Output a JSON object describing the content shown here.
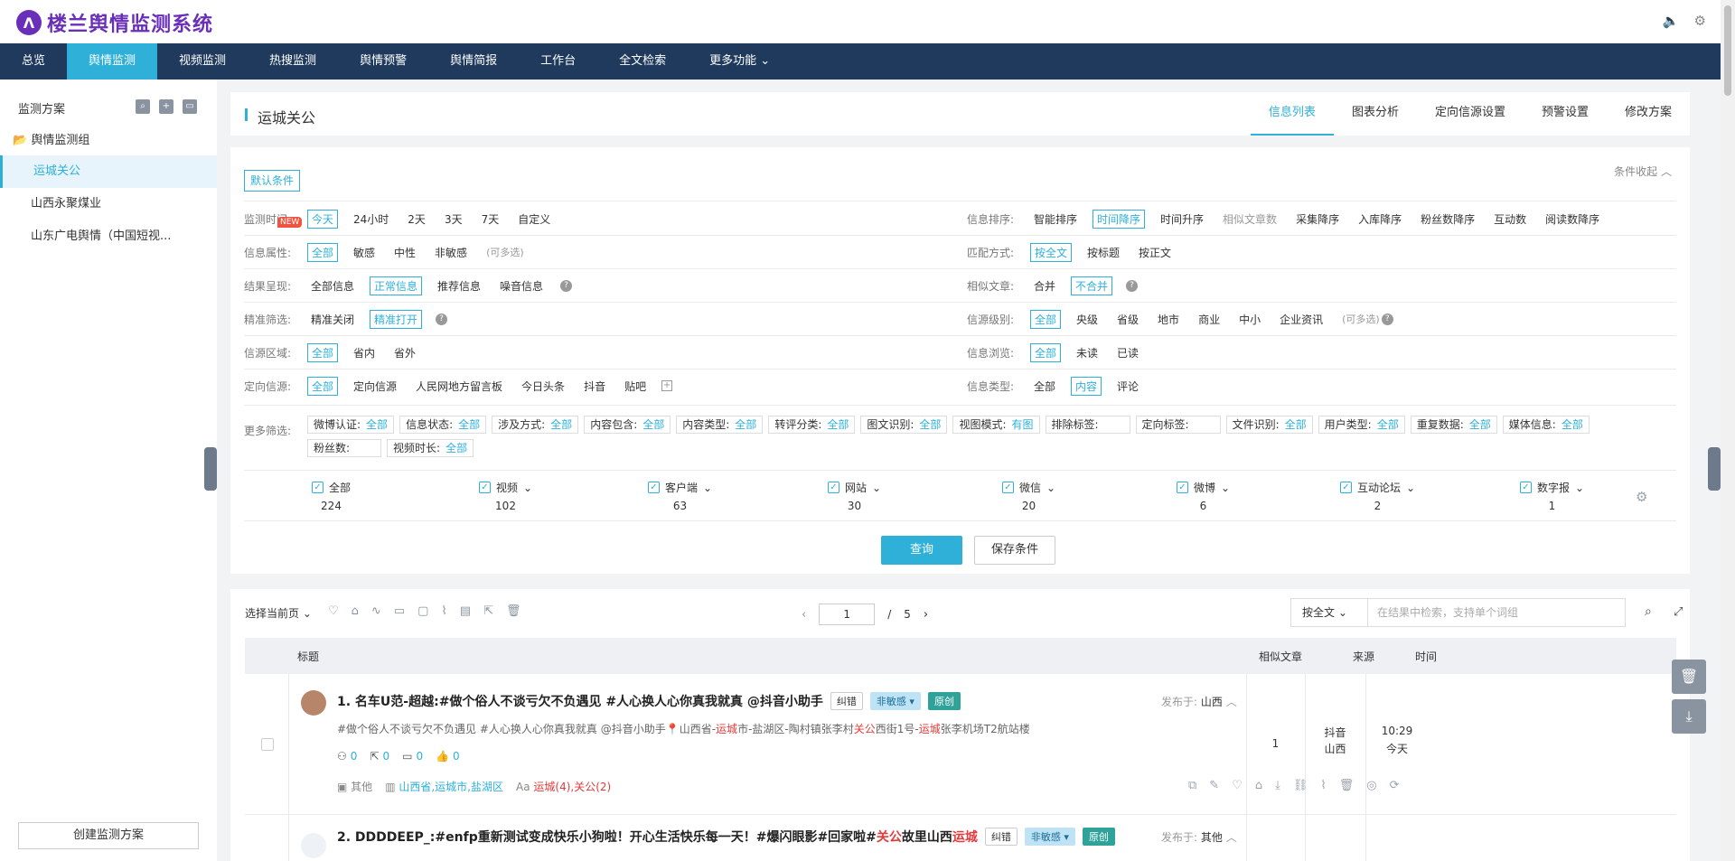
{
  "app": {
    "logo_char": "Λ",
    "title": "楼兰舆情监测系统"
  },
  "top_icons": [
    "speaker-icon",
    "gear-icon"
  ],
  "nav": [
    "总览",
    "舆情监测",
    "视频监测",
    "热搜监测",
    "舆情预警",
    "舆情简报",
    "工作台",
    "全文检索",
    "更多功能"
  ],
  "nav_active": 1,
  "sidebar": {
    "title": "监测方案",
    "group": "舆情监测组",
    "items": [
      "运城关公",
      "山西永聚煤业",
      "山东广电舆情（中国短视..."
    ],
    "active": 0,
    "create_label": "创建监测方案"
  },
  "header": {
    "title": "运城关公",
    "tabs": [
      "信息列表",
      "图表分析",
      "定向信源设置",
      "预警设置",
      "修改方案"
    ],
    "active_tab": 0
  },
  "filter": {
    "default_label": "默认条件",
    "collapse_label": "条件收起",
    "new_badge": "NEW",
    "left_rows": [
      {
        "label": "监测时间:",
        "options": [
          "今天",
          "24小时",
          "2天",
          "3天",
          "7天",
          "自定义"
        ],
        "selected": 0
      },
      {
        "label": "信息属性:",
        "options": [
          "全部",
          "敏感",
          "中性",
          "非敏感"
        ],
        "selected": 0,
        "hint": "(可多选)"
      },
      {
        "label": "结果呈现:",
        "options": [
          "全部信息",
          "正常信息",
          "推荐信息",
          "噪音信息"
        ],
        "selected": 1,
        "help": true
      },
      {
        "label": "精准筛选:",
        "options": [
          "精准关闭",
          "精准打开"
        ],
        "selected": 1,
        "help": true
      },
      {
        "label": "信源区域:",
        "options": [
          "全部",
          "省内",
          "省外"
        ],
        "selected": 0
      },
      {
        "label": "定向信源:",
        "options": [
          "全部",
          "定向信源",
          "人民网地方留言板",
          "今日头条",
          "抖音",
          "贴吧"
        ],
        "selected": 0,
        "add": true
      }
    ],
    "right_rows": [
      {
        "label": "信息排序:",
        "options": [
          "智能排序",
          "时间降序",
          "时间升序",
          "相似文章数",
          "采集降序",
          "入库降序",
          "粉丝数降序",
          "互动数",
          "阅读数降序"
        ],
        "selected": 1,
        "dim": 3
      },
      {
        "label": "匹配方式:",
        "options": [
          "按全文",
          "按标题",
          "按正文"
        ],
        "selected": 0
      },
      {
        "label": "相似文章:",
        "options": [
          "合并",
          "不合并"
        ],
        "selected": 1,
        "help": true
      },
      {
        "label": "信源级别:",
        "options": [
          "全部",
          "央级",
          "省级",
          "地市",
          "商业",
          "中小",
          "企业资讯"
        ],
        "selected": 0,
        "hint": "(可多选)",
        "help": true
      },
      {
        "label": "信息浏览:",
        "options": [
          "全部",
          "未读",
          "已读"
        ],
        "selected": 0
      },
      {
        "label": "信息类型:",
        "options": [
          "全部",
          "内容",
          "评论"
        ],
        "selected": 1
      }
    ],
    "more_label": "更多筛选:",
    "more_chips": [
      {
        "label": "微博认证:",
        "value": "全部"
      },
      {
        "label": "信息状态:",
        "value": "全部"
      },
      {
        "label": "涉及方式:",
        "value": "全部"
      },
      {
        "label": "内容包含:",
        "value": "全部"
      },
      {
        "label": "内容类型:",
        "value": "全部"
      },
      {
        "label": "转评分类:",
        "value": "全部"
      },
      {
        "label": "图文识别:",
        "value": "全部"
      },
      {
        "label": "视图模式:",
        "value": "有图"
      },
      {
        "label": "排除标签:",
        "value": ""
      },
      {
        "label": "定向标签:",
        "value": ""
      },
      {
        "label": "文件识别:",
        "value": "全部"
      },
      {
        "label": "用户类型:",
        "value": "全部"
      },
      {
        "label": "重复数据:",
        "value": "全部"
      },
      {
        "label": "媒体信息:",
        "value": "全部"
      },
      {
        "label": "粉丝数:",
        "value": ""
      },
      {
        "label": "视频时长:",
        "value": "全部"
      }
    ],
    "categories": [
      {
        "name": "全部",
        "count": "224",
        "dropdown": false
      },
      {
        "name": "视频",
        "count": "102",
        "dropdown": true
      },
      {
        "name": "客户端",
        "count": "63",
        "dropdown": true
      },
      {
        "name": "网站",
        "count": "30",
        "dropdown": true
      },
      {
        "name": "微信",
        "count": "20",
        "dropdown": true
      },
      {
        "name": "微博",
        "count": "6",
        "dropdown": true
      },
      {
        "name": "互动论坛",
        "count": "2",
        "dropdown": true
      },
      {
        "name": "数字报",
        "count": "1",
        "dropdown": true
      }
    ],
    "query_label": "查询",
    "save_label": "保存条件"
  },
  "list": {
    "select_label": "选择当前页",
    "toolbar_icons": [
      "heart-icon",
      "tag-icon",
      "trend-icon",
      "comment-icon",
      "message-icon",
      "wave-icon",
      "report-icon",
      "share-icon",
      "delete-icon"
    ],
    "page": "1",
    "page_sep": "/",
    "total_pages": "5",
    "search_mode": "按全文",
    "search_placeholder": "在结果中检索，支持单个词组",
    "columns": [
      "标题",
      "相似文章",
      "来源",
      "时间"
    ],
    "rows": [
      {
        "title": "1. 名车U范-超越:#做个俗人不谈亏欠不负遇见 #人心换人心你真我就真 @抖音小助手",
        "tag1": "纠错",
        "tag2": "非敏感",
        "tag3": "原创",
        "publish_label": "发布于:",
        "publish_place": "山西",
        "summary": {
          "p1": "#做个俗人不谈亏欠不负遇见 #人心换人心你真我就真 @抖音小助手",
          "pin": "📍",
          "p2": "山西省-",
          "k1": "运城",
          "p3": "市-盐湖区-陶村镇张李村",
          "k2": "关公",
          "p4": "西街1号-",
          "k3": "运城",
          "p5": "张李机场T2航站楼"
        },
        "stats": [
          "0",
          "0",
          "0",
          "0"
        ],
        "foot_type": "其他",
        "foot_region": "山西省,运城市,盐湖区",
        "foot_keywords": "运城(4),关公(2)",
        "similar": "1",
        "source_1": "抖音",
        "source_2": "山西",
        "time": "10:29",
        "date": "今天"
      },
      {
        "title_a": "2. DDDDEEP_:#enfp重新测试变成快乐小狗啦！开心生活快乐每一天！#爆闪眼影#回家啦#",
        "title_k1": "关公",
        "title_b": "故里山西",
        "title_k2": "运城",
        "tag1": "纠错",
        "tag2": "非敏感",
        "tag3": "原创",
        "publish_label": "发布于:",
        "publish_place": "其他"
      }
    ]
  }
}
